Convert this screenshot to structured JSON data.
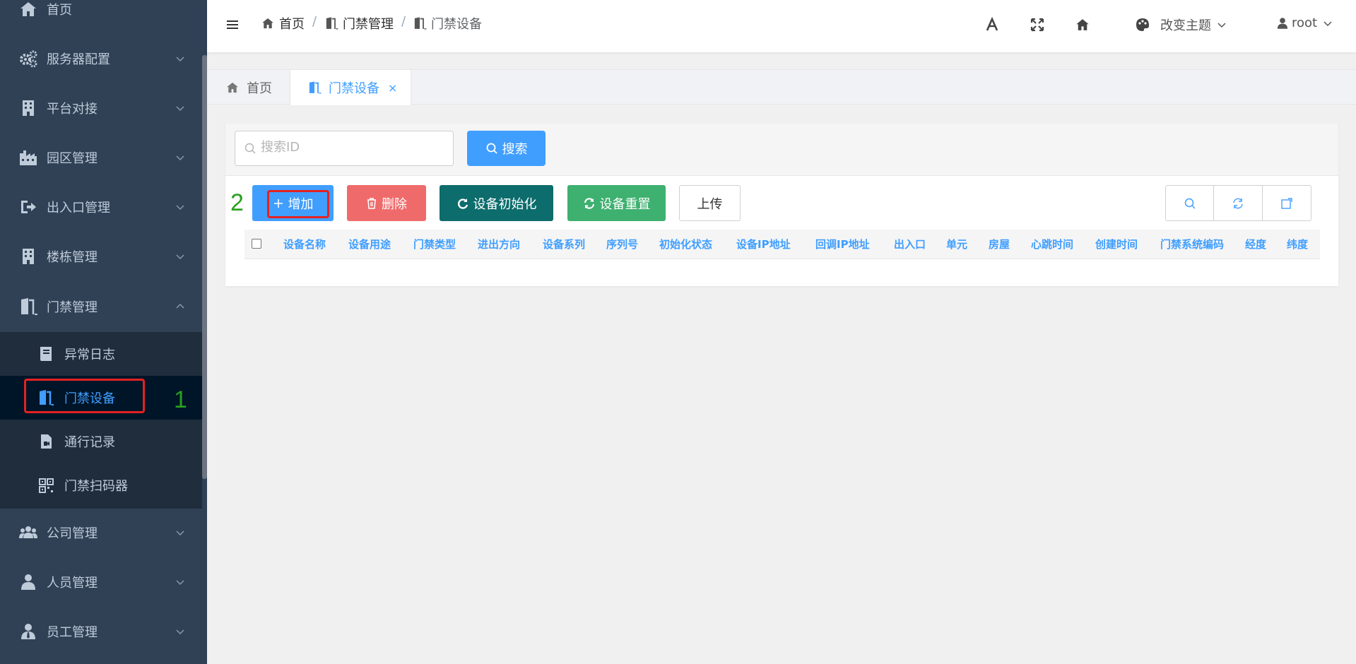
{
  "sidebar": {
    "home": "首页",
    "items": [
      {
        "label": "服务器配置"
      },
      {
        "label": "平台对接"
      },
      {
        "label": "园区管理"
      },
      {
        "label": "出入口管理"
      },
      {
        "label": "楼栋管理"
      },
      {
        "label": "门禁管理"
      },
      {
        "label": "公司管理"
      },
      {
        "label": "人员管理"
      },
      {
        "label": "员工管理"
      }
    ],
    "submenu": [
      {
        "label": "异常日志"
      },
      {
        "label": "门禁设备"
      },
      {
        "label": "通行记录"
      },
      {
        "label": "门禁扫码器"
      }
    ]
  },
  "annotations": {
    "one": "1",
    "two": "2"
  },
  "navbar": {
    "breadcrumb": [
      "首页",
      "门禁管理",
      "门禁设备"
    ],
    "separator": "/",
    "theme_label": "改变主题",
    "user": "root"
  },
  "tags": {
    "home": "首页",
    "active": "门禁设备",
    "close": "×"
  },
  "search": {
    "placeholder": "搜索ID",
    "button": "搜索"
  },
  "toolbar": {
    "add": "增加",
    "delete": "删除",
    "init": "设备初始化",
    "reset": "设备重置",
    "upload": "上传"
  },
  "table": {
    "columns": [
      "设备名称",
      "设备用途",
      "门禁类型",
      "进出方向",
      "设备系列",
      "序列号",
      "初始化状态",
      "设备IP地址",
      "回调IP地址",
      "出入口",
      "单元",
      "房屋",
      "心跳时间",
      "创建时间",
      "门禁系统编码",
      "经度",
      "纬度"
    ]
  },
  "colors": {
    "sidebar_bg": "#304156",
    "submenu_bg": "#1f2d3d",
    "active_bg": "#001528",
    "primary": "#409eff",
    "danger": "#ef6b6b",
    "teal": "#0d6c6c",
    "success": "#3eb06f",
    "annotation_red": "#e32222",
    "annotation_green": "#28a01e"
  }
}
